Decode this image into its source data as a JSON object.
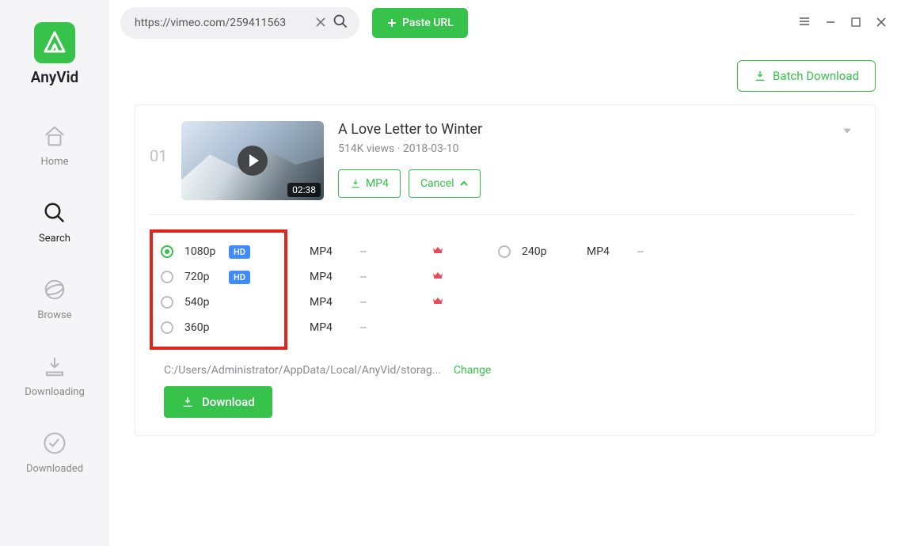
{
  "app_name": "AnyVid",
  "nav": {
    "home": "Home",
    "search": "Search",
    "browse": "Browse",
    "downloading": "Downloading",
    "downloaded": "Downloaded"
  },
  "search": {
    "value": "https://vimeo.com/259411563",
    "paste_label": "Paste URL"
  },
  "batch_label": "Batch Download",
  "result": {
    "index": "01",
    "duration": "02:38",
    "title": "A Love Letter to Winter",
    "views": "514K views",
    "date": "2018-03-10",
    "mp4_label": "MP4",
    "cancel_label": "Cancel"
  },
  "qualities_left": [
    {
      "label": "1080p",
      "fmt": "MP4",
      "size": "--",
      "hd": true,
      "crown": true,
      "selected": true
    },
    {
      "label": "720p",
      "fmt": "MP4",
      "size": "--",
      "hd": true,
      "crown": true,
      "selected": false
    },
    {
      "label": "540p",
      "fmt": "MP4",
      "size": "--",
      "hd": false,
      "crown": true,
      "selected": false
    },
    {
      "label": "360p",
      "fmt": "MP4",
      "size": "--",
      "hd": false,
      "crown": false,
      "selected": false
    }
  ],
  "qualities_right": [
    {
      "label": "240p",
      "fmt": "MP4",
      "size": "--",
      "selected": false
    }
  ],
  "hd_badge": "HD",
  "save_path": "C:/Users/Administrator/AppData/Local/AnyVid/storag...",
  "change_label": "Change",
  "download_label": "Download"
}
